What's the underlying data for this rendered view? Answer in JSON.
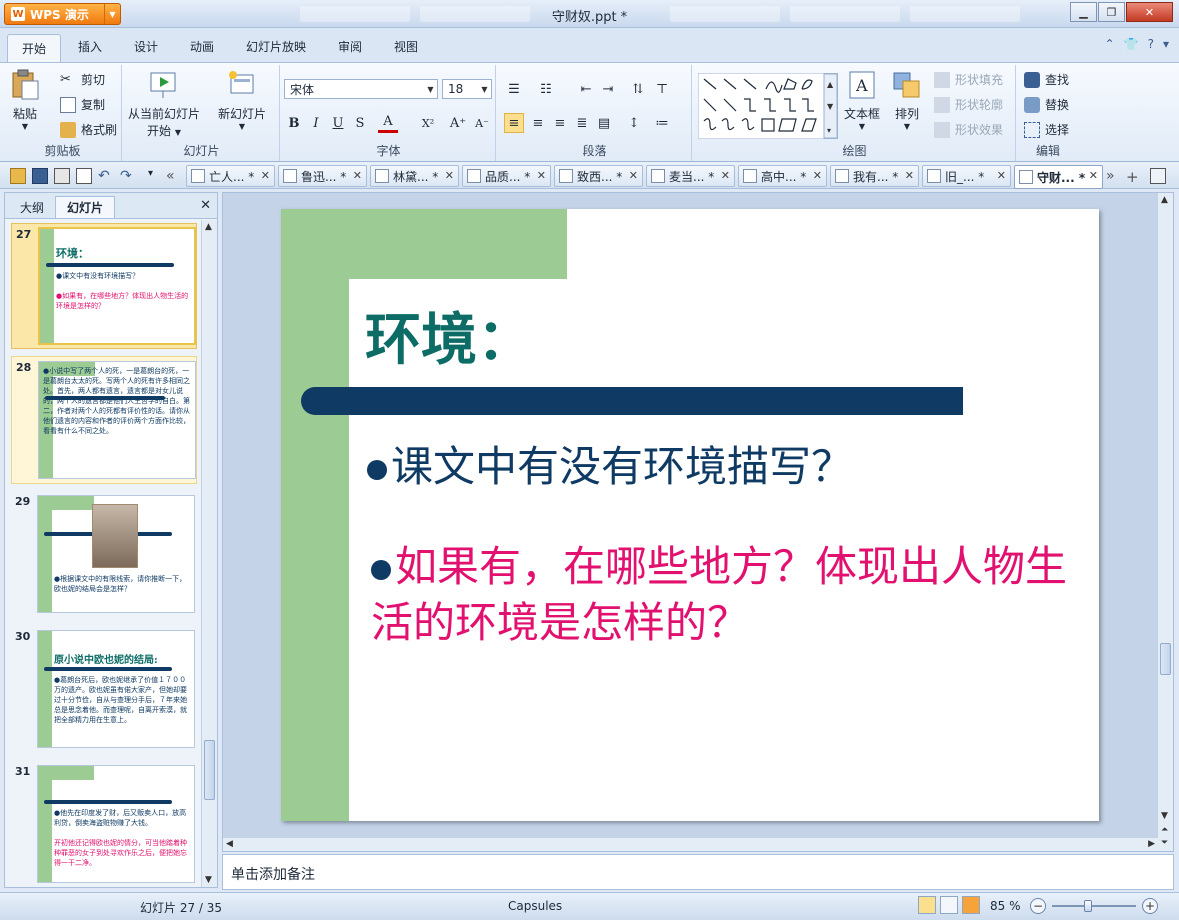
{
  "app": {
    "button_label": "WPS 演示",
    "window_title": "守财奴.ppt *"
  },
  "ribbon_tabs": [
    "开始",
    "插入",
    "设计",
    "动画",
    "幻灯片放映",
    "审阅",
    "视图"
  ],
  "clipboard": {
    "paste": "粘贴",
    "cut": "剪切",
    "copy": "复制",
    "format_painter": "格式刷",
    "label": "剪贴板"
  },
  "slides_group": {
    "from_current": "从当前幻灯片",
    "start": "开始",
    "new_slide": "新幻灯片",
    "label": "幻灯片"
  },
  "font_group": {
    "font_name": "宋体",
    "font_size": "18",
    "label": "字体"
  },
  "paragraph_group": {
    "label": "段落"
  },
  "drawing_group": {
    "textbox": "文本框",
    "arrange": "排列",
    "shape_fill": "形状填充",
    "shape_outline": "形状轮廓",
    "shape_effect": "形状效果",
    "label": "绘图"
  },
  "edit_group": {
    "find": "查找",
    "replace": "替换",
    "select": "选择",
    "label": "编辑"
  },
  "doc_tabs": [
    {
      "label": "亡人... *"
    },
    {
      "label": "鲁迅... *"
    },
    {
      "label": "林黛... *"
    },
    {
      "label": "品质... *"
    },
    {
      "label": "致西... *"
    },
    {
      "label": "麦当... *"
    },
    {
      "label": "高中... *"
    },
    {
      "label": "我有... *"
    },
    {
      "label": "旧_... *"
    },
    {
      "label": "守财... *"
    }
  ],
  "left_pane": {
    "tabs": [
      "大纲",
      "幻灯片"
    ],
    "thumbnails": [
      {
        "num": "27",
        "title": "环境：",
        "lines": [
          "●课文中有没有环境描写？"
        ],
        "pink_lines": [
          "●如果有，在哪些地方？体现出人物生活的环境是怎样的？"
        ]
      },
      {
        "num": "28",
        "title": "",
        "lines": [
          "●小说中写了两个人的死，一是葛朗台的死，一是葛朗台太太的死。写两个人的死有许多相同之处。首先，两人都有遗言，遗言都是对女儿说的，两个人的遗言都是他们人生哲学的自白。第二，作者对两个人的死都有评价性的话。请你从他们遗言的内容和作者的评价两个方面作比较，看看有什么不同之处。"
        ],
        "pink_lines": []
      },
      {
        "num": "29",
        "title": "",
        "lines": [
          "●根据课文中的有限线索，请你推断一下，欧也妮的结局会是怎样？"
        ],
        "pink_lines": []
      },
      {
        "num": "30",
        "title": "原小说中欧也妮的结局:",
        "lines": [
          "●葛朗台死后，欧也妮继承了价值１７００万的遗产。欧也妮虽有偌大家产，但她却要过十分节俭，自从与查理分手后，７年来她总是思念着他。而查理呢，自离开索漠，就把全部精力用在生意上。"
        ],
        "pink_lines": []
      },
      {
        "num": "31",
        "title": "",
        "lines": [
          "●他先在印度发了财，后又贩卖人口，放高利贷，倒卖海盗赃物赚了大钱。"
        ],
        "pink_lines": [
          "开初他还记得欧也妮的情分，可当他踏着种种罪恶的女子到处寻欢作乐之后，便把她忘得一干二净。"
        ]
      }
    ]
  },
  "slide": {
    "title": "环境：",
    "bullet1": "课文中有没有环境描写？",
    "bullet2": "如果有，在哪些地方？体现出人物生活的环境是怎样的？"
  },
  "notes_placeholder": "单击添加备注",
  "status": {
    "slide_counter": "幻灯片 27 / 35",
    "theme": "Capsules",
    "zoom": "85 %",
    "zoom_fraction": 0.85
  },
  "colors": {
    "title_teal": "#0d6d66",
    "navy": "#0f3a63",
    "pink": "#e2106e",
    "green": "#9ccb94",
    "wps_orange": "#f07a10"
  }
}
